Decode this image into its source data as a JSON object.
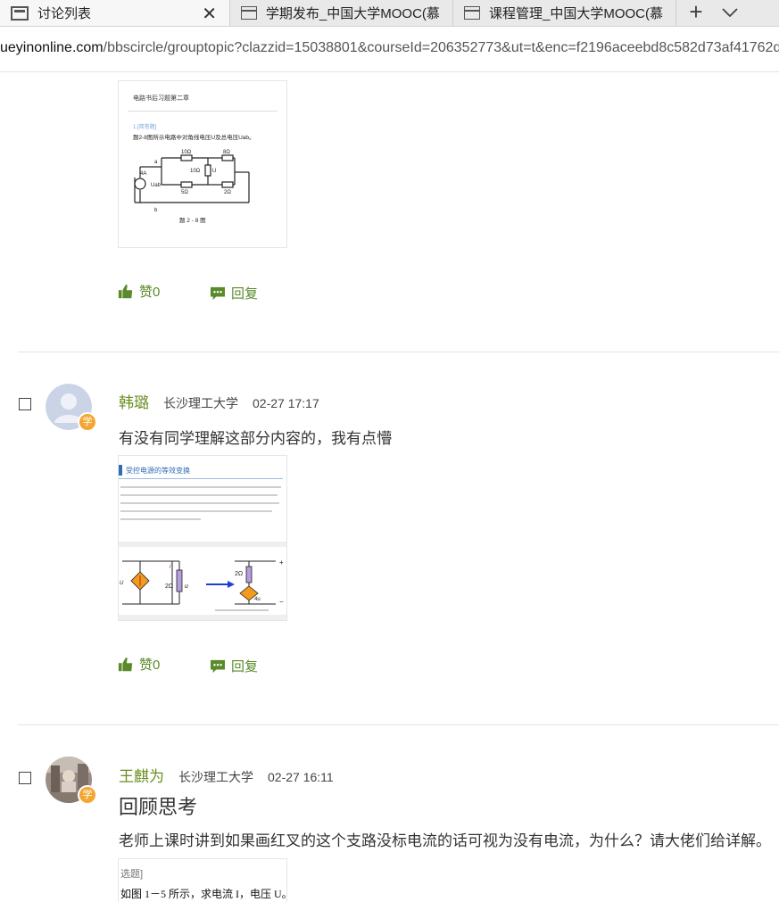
{
  "tabs": [
    {
      "title": "讨论列表",
      "active": true
    },
    {
      "title": "学期发布_中国大学MOOC(慕",
      "active": false
    },
    {
      "title": "课程管理_中国大学MOOC(慕",
      "active": false
    }
  ],
  "address": {
    "host": "ueyinonline.com",
    "path": "/bbscircle/grouptopic?clazzid=15038801&courseId=206352773&ut=t&enc=f2196aceebd8c582d73af41762d"
  },
  "actions": {
    "like_label": "赞0",
    "reply_label": "回复"
  },
  "thumb1": {
    "heading": "电路书后习题第二章",
    "qtype": "1.[简答题]",
    "question": "题2-8图所示电路中对角线电压U及总电压Uab。",
    "r1": "10Ω",
    "r2": "8Ω",
    "r3": "10Ω",
    "r4": "5Ω",
    "r5": "2Ω",
    "source": "4A",
    "uab": "Uab",
    "u": "U",
    "node_a": "a",
    "node_b": "b",
    "caption": "题 2 - 8 图"
  },
  "posts": [
    {
      "author": "韩璐",
      "school": "长沙理工大学",
      "time": "02-27 17:17",
      "text": "有没有同学理解这部分内容的，我有点懵",
      "badge": "学",
      "thumb": {
        "heading": "受控电源的等效变换",
        "r_left": "2Ω",
        "r_right": "2Ω",
        "u": "u",
        "i": "i",
        "u4": "4u",
        "label_u": "U",
        "plus": "+",
        "minus": "−"
      }
    },
    {
      "author": "王麒为",
      "school": "长沙理工大学",
      "time": "02-27 16:11",
      "title": "回顾思考",
      "text": "老师上课时讲到如果画红叉的这个支路没标电流的话可视为没有电流，为什么？请大佬们给详解。",
      "badge": "学",
      "thumb": {
        "line1": "选题]",
        "line2": "如图 1－5 所示，求电流 I，电压 U。"
      }
    }
  ],
  "colors": {
    "accent_green": "#6b8e23",
    "action_green": "#5a8a2a",
    "badge_orange": "#f3a632"
  }
}
